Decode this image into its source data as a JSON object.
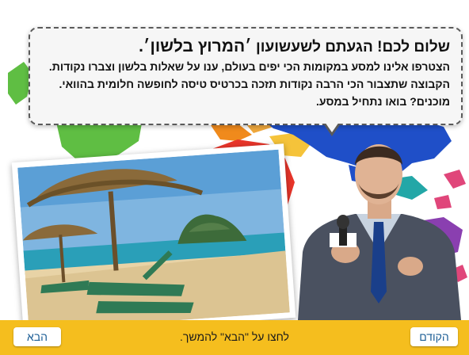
{
  "bubble": {
    "title_prefix": "שלום לכם! הגעתם לשעשועון",
    "title_quote": "׳המרוץ בלשון׳.",
    "line1": "הצטרפו אלינו למסע במקומות הכי יפים בעולם, ענו על שאלות בלשון וצברו נקודות.",
    "line2": "הקבוצה שתצבור הכי הרבה נקודות תזכה בכרטיס טיסה לחופשה חלומית בהוואי.",
    "line3": "מוכנים? בואו נתחיל במסע."
  },
  "footer": {
    "prev_label": "הקודם",
    "next_label": "הבא",
    "instruction": "לחצו על \"הבא\" להמשך."
  },
  "colors": {
    "bar": "#f5be1e",
    "button_text": "#1b5d95",
    "map_green": "#5fbe43",
    "map_red": "#e8352a",
    "map_blue": "#1f4fc8",
    "map_orange": "#f08a1c",
    "map_purple": "#8a3fb0",
    "map_pink": "#e0467a",
    "map_teal": "#23a7a7"
  },
  "icons": {
    "map": "world-map-illustration",
    "photo": "beach-photo",
    "host": "presenter-with-microphone"
  }
}
